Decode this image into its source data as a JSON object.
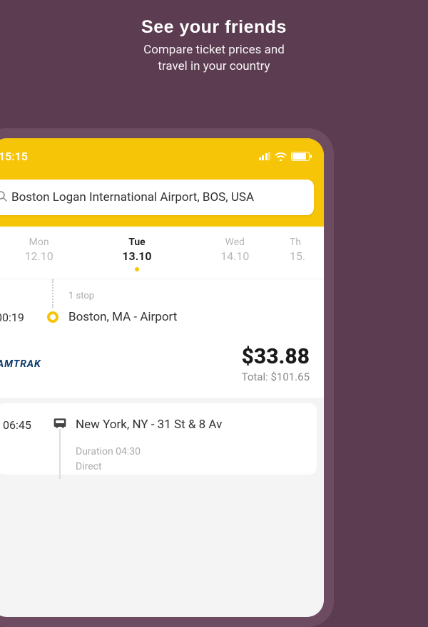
{
  "hero": {
    "title": "See your friends",
    "subtitle_line1": "Compare ticket prices and",
    "subtitle_line2": "travel in your country"
  },
  "status": {
    "time": "15:15"
  },
  "search": {
    "value": "Boston Logan International Airport, BOS, USA"
  },
  "dates": [
    {
      "day": "Mon",
      "date": "12.10",
      "active": false
    },
    {
      "day": "Tue",
      "date": "13.10",
      "active": true
    },
    {
      "day": "Wed",
      "date": "14.10",
      "active": false
    },
    {
      "day": "Th",
      "date": "15.",
      "active": false
    }
  ],
  "result1": {
    "stops_label": "1 stop",
    "time": "00:19",
    "place": "Boston, MA - Airport",
    "carrier": "AMTRAK",
    "price": "$33.88",
    "total": "Total: $101.65"
  },
  "result2": {
    "time": "06:45",
    "place": "New York, NY - 31 St & 8 Av",
    "duration": "Duration 04:30",
    "direct": "Direct"
  }
}
